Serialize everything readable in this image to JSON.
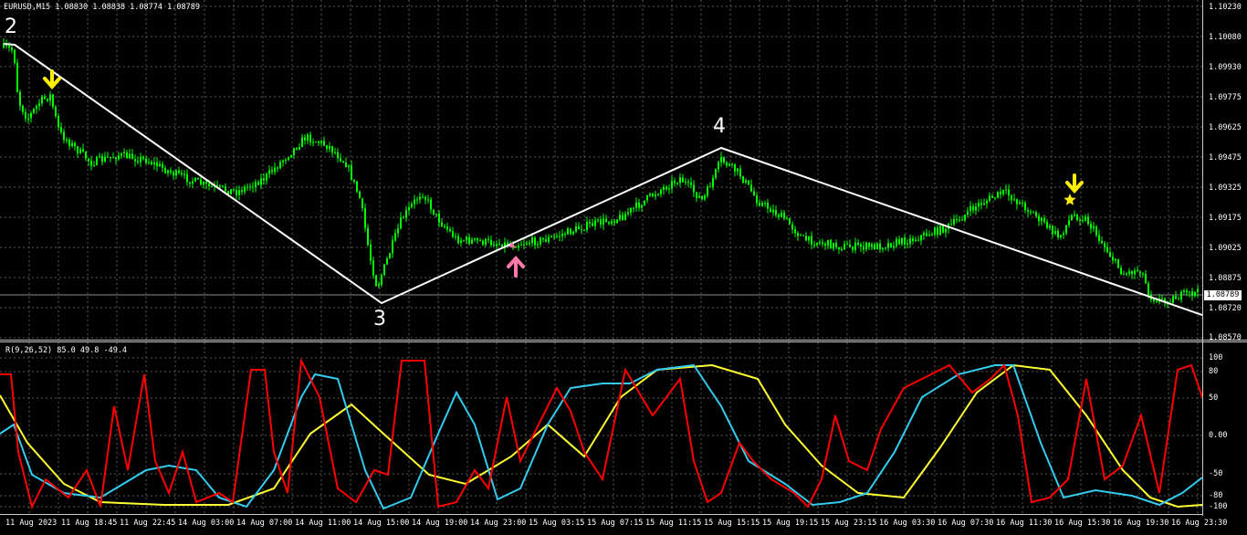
{
  "chart": {
    "symbol_line": "EURUSD,M15  1.08830 1.08838 1.08774 1.08789",
    "current_price": "1.08789",
    "colors": {
      "candle": "#00ff00",
      "wave_line": "#ffffff",
      "grid": "#5a5a5a",
      "rsi_fast": "#ff0000",
      "rsi_mid": "#33ccee",
      "rsi_slow": "#ffff33",
      "arrow_sell": "#ffee00",
      "arrow_buy": "#ff77aa"
    },
    "wave_labels": [
      "2",
      "3",
      "4"
    ],
    "icons": [
      "sell-arrow-icon",
      "buy-arrow-icon",
      "star-icon"
    ]
  },
  "price_axis": [
    "1.10230",
    "1.10080",
    "1.09930",
    "1.09775",
    "1.09625",
    "1.09475",
    "1.09325",
    "1.09175",
    "1.09025",
    "1.08875",
    "1.08720",
    "1.08570"
  ],
  "indicator": {
    "title": "R(9,26,52) 85.0 49.8 -49.4",
    "levels": [
      "100",
      "80",
      "50",
      "0.00",
      "-50",
      "-80",
      "-100"
    ]
  },
  "time_axis": [
    "11 Aug 2023",
    "11 Aug 18:45",
    "11 Aug 22:45",
    "14 Aug 03:00",
    "14 Aug 07:00",
    "14 Aug 11:00",
    "14 Aug 15:00",
    "14 Aug 19:00",
    "14 Aug 23:00",
    "15 Aug 03:15",
    "15 Aug 07:15",
    "15 Aug 11:15",
    "15 Aug 15:15",
    "15 Aug 19:15",
    "15 Aug 23:15",
    "16 Aug 03:30",
    "16 Aug 07:30",
    "16 Aug 11:30",
    "16 Aug 15:30",
    "16 Aug 19:30",
    "16 Aug 23:30"
  ]
}
